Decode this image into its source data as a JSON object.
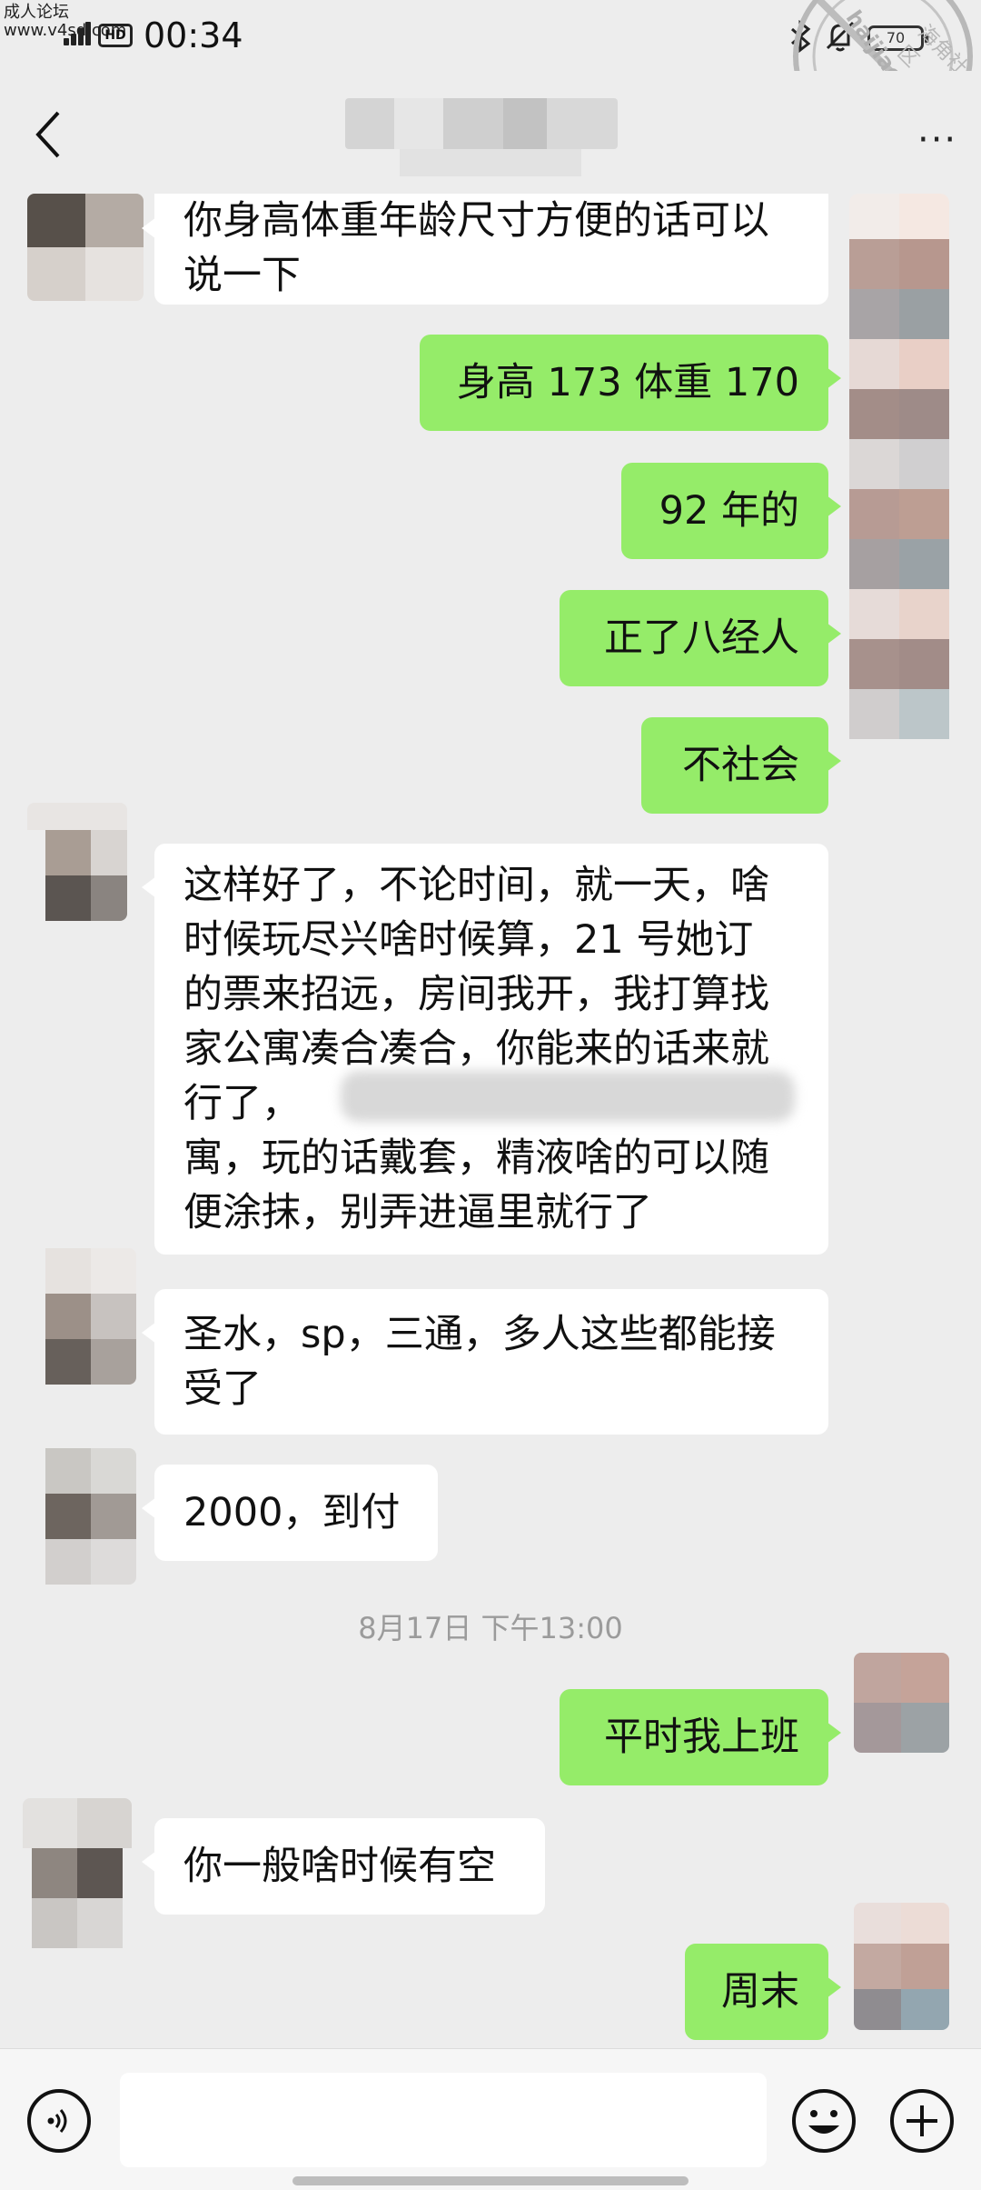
{
  "status_bar": {
    "watermark_line1": "成人论坛",
    "watermark_line2": "www.v4sd.com",
    "network_badge": "HD",
    "time": "00:34",
    "battery_text": "70"
  },
  "stamp": {
    "ring_text": "海角社区",
    "domain": "haijiao.com"
  },
  "header": {
    "more_label": "···"
  },
  "messages": [
    {
      "side": "in",
      "lines": [
        "你身高体重年龄尺寸方便的话可以",
        "说一下"
      ]
    },
    {
      "side": "out",
      "lines": [
        "身高 173 体重 170"
      ]
    },
    {
      "side": "out",
      "lines": [
        "92 年的"
      ]
    },
    {
      "side": "out",
      "lines": [
        "正了八经人"
      ]
    },
    {
      "side": "out",
      "lines": [
        "不社会"
      ]
    },
    {
      "side": "in",
      "lines": [
        "这样好了，不论时间，就一天，啥",
        "时候玩尽兴啥时候算，21 号她订",
        "的票来招远，房间我开，我打算找",
        "家公寓凑合凑合，你能来的话来就",
        "行了，",
        "寓，玩的话戴套，精液啥的可以随",
        "便涂抹，别弄进逼里就行了"
      ]
    },
    {
      "side": "in",
      "lines": [
        "圣水，sp，三通，多人这些都能接",
        "受了"
      ]
    },
    {
      "side": "in",
      "lines": [
        "2000，到付"
      ]
    },
    {
      "side": "out",
      "lines": [
        "平时我上班"
      ]
    },
    {
      "side": "in",
      "lines": [
        "你一般啥时候有空"
      ]
    },
    {
      "side": "out",
      "lines": [
        "周末"
      ]
    }
  ],
  "timestamp": "8月17日 下午13:00",
  "colors": {
    "background": "#ededed",
    "outgoing_bubble": "#95ec69",
    "incoming_bubble": "#ffffff",
    "timestamp_text": "#9b9b9b"
  },
  "input_bar": {
    "voice_icon": "voice-icon",
    "emoji_icon": "emoji-icon",
    "plus_icon": "plus-icon",
    "input_value": ""
  }
}
